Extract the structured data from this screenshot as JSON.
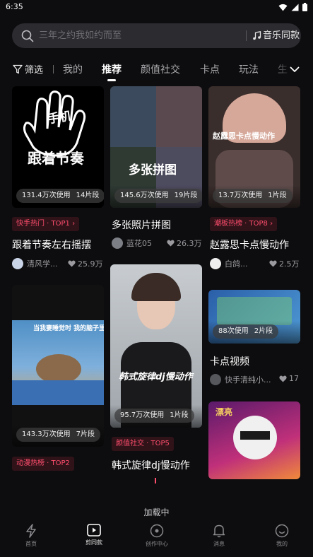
{
  "status": {
    "time": "6:35"
  },
  "search": {
    "placeholder": "三年之约我如约而至",
    "music_label": "音乐同款"
  },
  "tabs": {
    "filter_label": "筛选",
    "items": [
      "我的",
      "推荐",
      "颜值社交",
      "卡点",
      "玩法",
      "生"
    ],
    "active": "推荐"
  },
  "cards": [
    {
      "image_text": "跟着节奏",
      "usage": "131.4万次使用",
      "segments": "14片段",
      "badge": "快手热门 · TOP1 ›",
      "title": "跟着节奏左右摇摆",
      "author": "清风学...",
      "likes": "25.9万"
    },
    {
      "image_text": "多张拼图",
      "usage": "145.6万次使用",
      "segments": "19片段",
      "title": "多张照片拼图",
      "author": "蓝花05",
      "likes": "26.3万"
    },
    {
      "image_text": "赵露思卡点慢动作",
      "usage": "13.7万次使用",
      "segments": "1片段",
      "badge": "潮板热榜 · TOP8 ›",
      "title": "赵露思卡点慢动作",
      "author": "白鸽...",
      "likes": "2.5万"
    },
    {
      "image_text": "当我妻睡觉时 我的脑子里都是:",
      "usage": "143.3万次使用",
      "segments": "7片段",
      "badge": "动漫热榜 · TOP2"
    },
    {
      "image_text": "韩式旋律dj慢动作",
      "usage": "95.7万次使用",
      "segments": "1片段",
      "badge": "颜值社交 · TOP5",
      "title": "韩式旋律dj慢动作"
    },
    {
      "usage": "88次使用",
      "segments": "2片段",
      "title": "卡点视频",
      "author": "快手清纯小...",
      "likes": "17"
    },
    {
      "image_text": "漂亮"
    }
  ],
  "loading_text": "加载中",
  "bottom_nav": [
    "首页",
    "剪同款",
    "创作中心",
    "消息",
    "我的"
  ],
  "colors": {
    "accent": "#ff4d6d",
    "background": "#0d0d0f"
  }
}
